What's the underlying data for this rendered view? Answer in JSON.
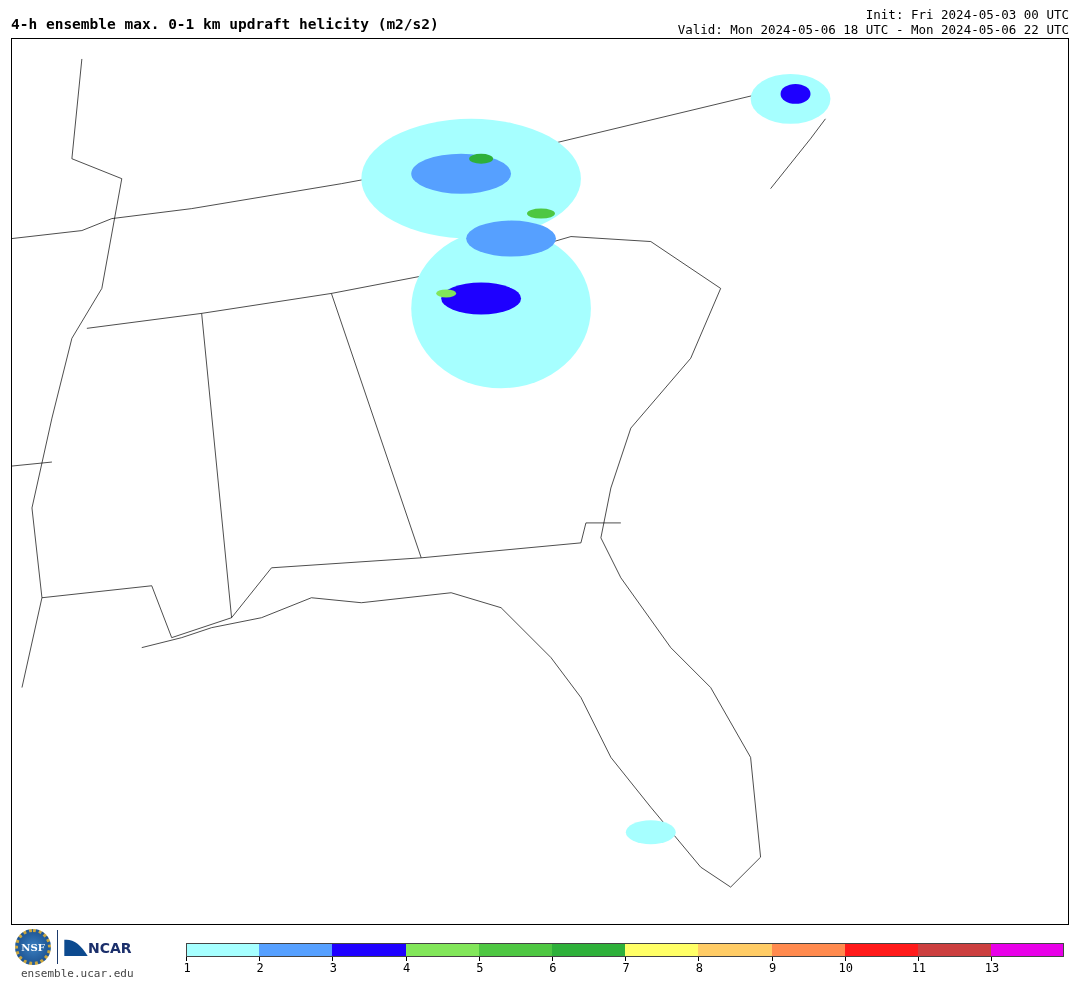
{
  "title": "4-h ensemble max. 0-1 km updraft helicity (m2/s2)",
  "init": "Init: Fri 2024-05-03 00 UTC",
  "valid": "Valid: Mon 2024-05-06 18 UTC - Mon 2024-05-06 22 UTC",
  "logos": {
    "nsf": "NSF",
    "ncar": "NCAR",
    "site": "ensemble.ucar.edu"
  },
  "colorbar": [
    {
      "label": "1",
      "color": "#a6ffff"
    },
    {
      "label": "2",
      "color": "#56a0ff"
    },
    {
      "label": "3",
      "color": "#1e00ff"
    },
    {
      "label": "4",
      "color": "#82e65a"
    },
    {
      "label": "5",
      "color": "#4ec742"
    },
    {
      "label": "6",
      "color": "#2eb03a"
    },
    {
      "label": "7",
      "color": "#ffff66"
    },
    {
      "label": "8",
      "color": "#ffcc66"
    },
    {
      "label": "9",
      "color": "#ff8a4e"
    },
    {
      "label": "10",
      "color": "#ff1a1a"
    },
    {
      "label": "11",
      "color": "#cc3f3f"
    },
    {
      "label": "13",
      "color": "#e800e8"
    }
  ]
}
